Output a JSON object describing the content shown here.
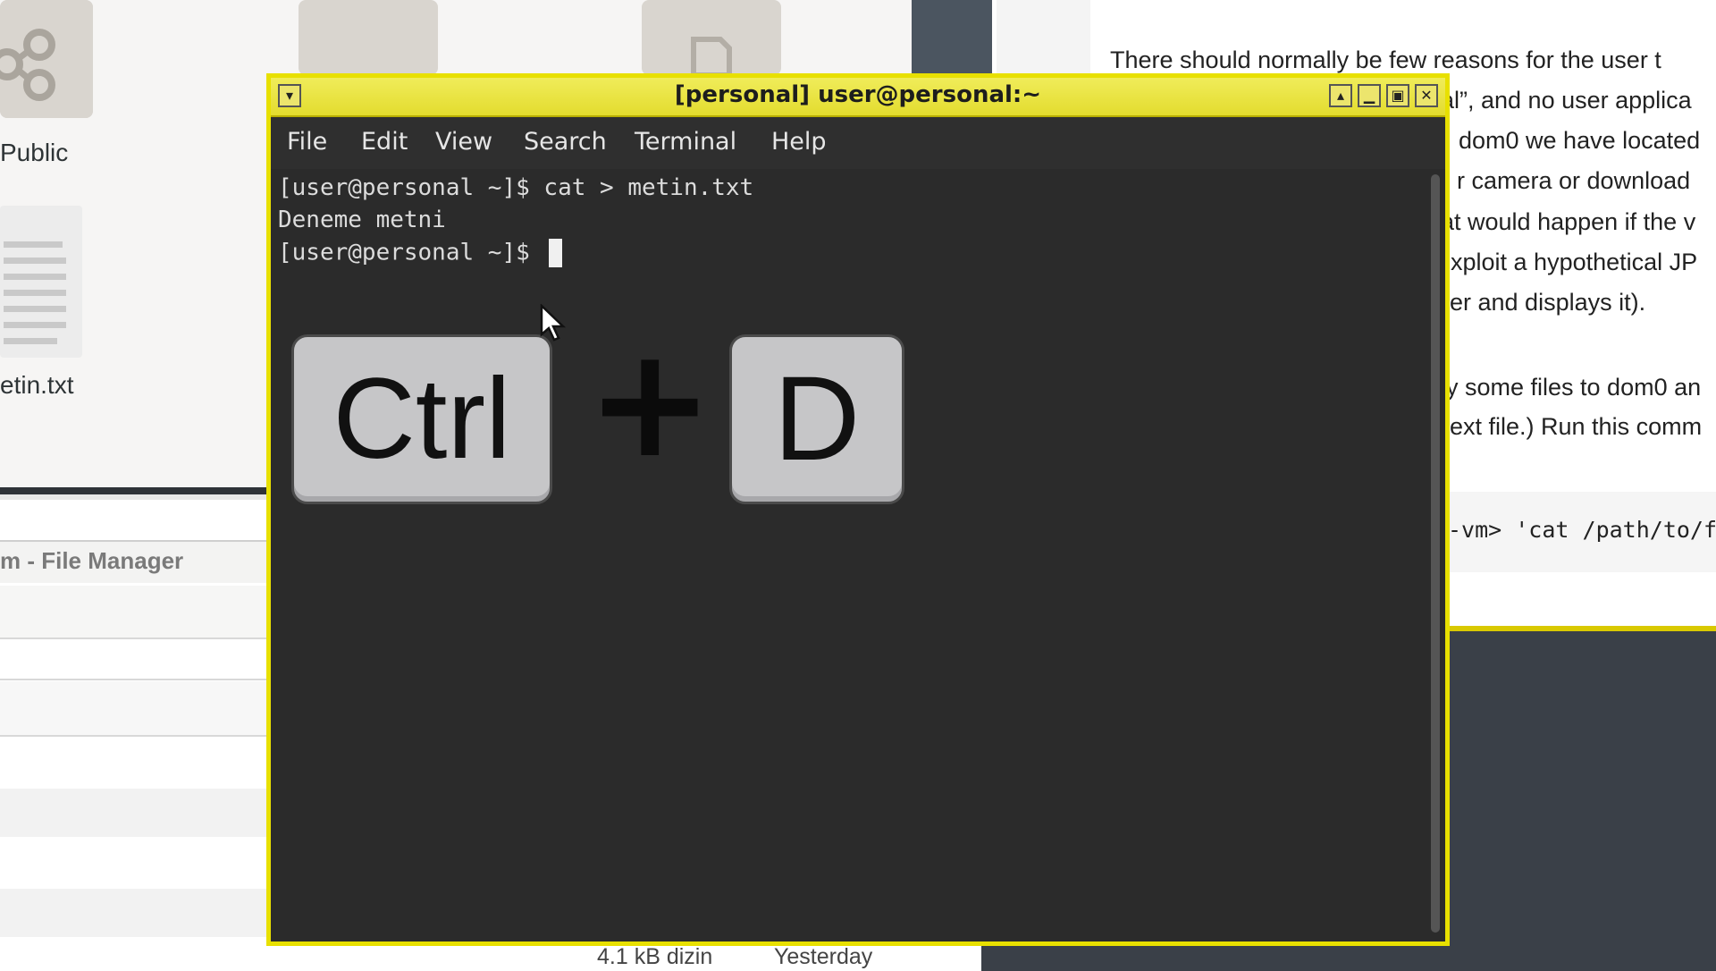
{
  "background_files": {
    "public_caption": "Public",
    "file_caption": "etin.txt"
  },
  "file_manager2": {
    "title": "m - File Manager",
    "status_size": "4.1 kB dizin",
    "status_date": "Yesterday"
  },
  "doc_window": {
    "lines": [
      "There should normally be few reasons for the user t",
      "al”, and no user applica",
      "dom0 we have located",
      "r camera or download",
      "at would happen if the v",
      "xploit a hypothetical JP",
      "er and displays it).",
      "y some files to dom0 an",
      "ext file.) Run this comm"
    ],
    "code": "-vm> 'cat /path/to/f"
  },
  "terminal": {
    "title": "[personal] user@personal:~",
    "menu": [
      "File",
      "Edit",
      "View",
      "Search",
      "Terminal",
      "Help"
    ],
    "lines": [
      "[user@personal ~]$ cat > metin.txt",
      "Deneme metni",
      "[user@personal ~]$ "
    ]
  },
  "shortcut_overlay": {
    "key1": "Ctrl",
    "plus": "+",
    "key2": "D"
  },
  "colors": {
    "titlebar_accent": "#e8e000",
    "terminal_bg": "#2b2b2b"
  }
}
